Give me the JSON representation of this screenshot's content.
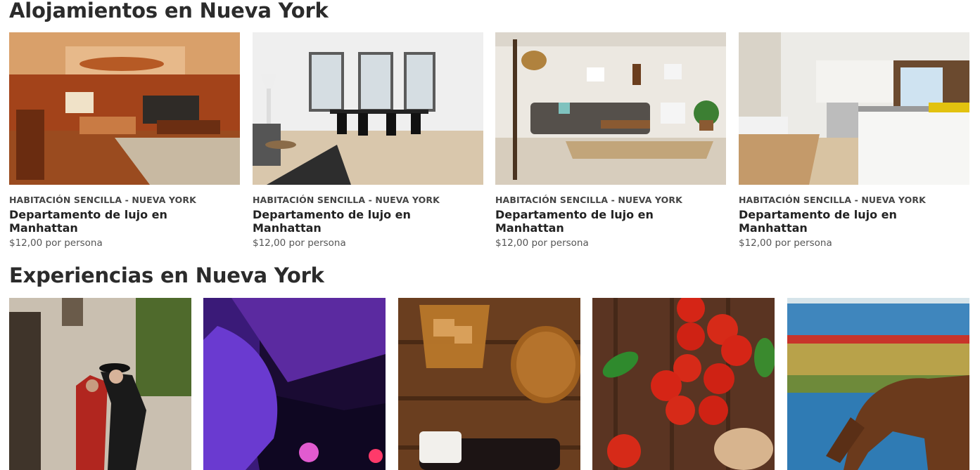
{
  "sections": {
    "stays_title": "Alojamientos en Nueva York",
    "experiences_title": "Experiencias en Nueva York"
  },
  "stays": [
    {
      "meta": "HABITACIÓN SENCILLA - NUEVA YORK",
      "name": "Departamento de lujo en Manhattan",
      "price": "$12,00 por persona",
      "photo": "living-room-billiards-photo"
    },
    {
      "meta": "HABITACIÓN SENCILLA - NUEVA YORK",
      "name": "Departamento de lujo en Manhattan",
      "price": "$12,00 por persona",
      "photo": "white-dining-room-photo"
    },
    {
      "meta": "HABITACIÓN SENCILLA - NUEVA YORK",
      "name": "Departamento de lujo en Manhattan",
      "price": "$12,00 por persona",
      "photo": "living-room-sofa-photo"
    },
    {
      "meta": "HABITACIÓN SENCILLA - NUEVA YORK",
      "name": "Departamento de lujo en Manhattan",
      "price": "$12,00 por persona",
      "photo": "white-kitchen-photo"
    }
  ],
  "experiences": [
    {
      "photo": "tango-dancers-photo"
    },
    {
      "photo": "purple-nightclub-photo"
    },
    {
      "photo": "whisky-glasses-photo"
    },
    {
      "photo": "tomatoes-basil-photo"
    },
    {
      "photo": "horse-grazing-photo"
    }
  ]
}
